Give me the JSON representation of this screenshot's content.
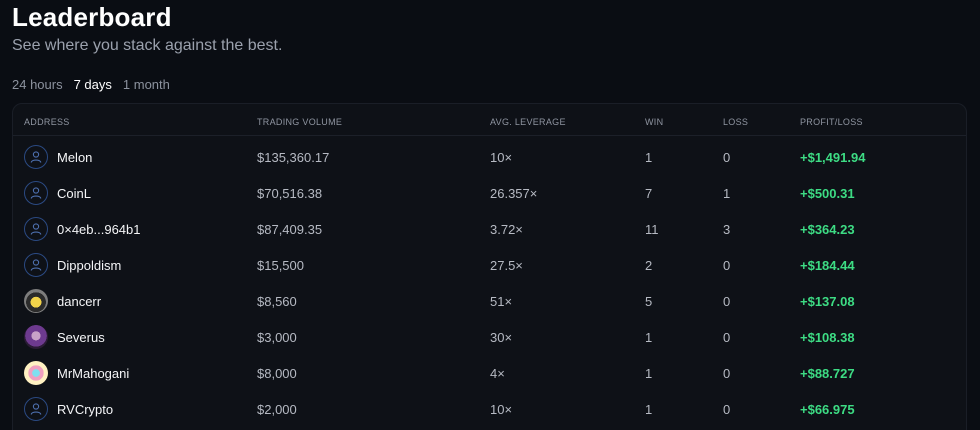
{
  "header": {
    "title": "Leaderboard",
    "subtitle": "See where you stack against the best."
  },
  "tabs": [
    {
      "label": "24 hours",
      "active": false
    },
    {
      "label": "7 days",
      "active": true
    },
    {
      "label": "1 month",
      "active": false
    }
  ],
  "table": {
    "columns": [
      "ADDRESS",
      "TRADING VOLUME",
      "AVG. LEVERAGE",
      "WIN",
      "LOSS",
      "PROFIT/LOSS"
    ],
    "rows": [
      {
        "name": "Melon",
        "avatar": "user-icon",
        "volume": "$135,360.17",
        "leverage": "10×",
        "win": "1",
        "loss": "0",
        "profit": "+$1,491.94"
      },
      {
        "name": "CoinL",
        "avatar": "user-icon",
        "volume": "$70,516.38",
        "leverage": "26.357×",
        "win": "7",
        "loss": "1",
        "profit": "+$500.31"
      },
      {
        "name": "0×4eb...964b1",
        "avatar": "user-icon",
        "volume": "$87,409.35",
        "leverage": "3.72×",
        "win": "11",
        "loss": "3",
        "profit": "+$364.23"
      },
      {
        "name": "Dippoldism",
        "avatar": "user-icon",
        "volume": "$15,500",
        "leverage": "27.5×",
        "win": "2",
        "loss": "0",
        "profit": "+$184.44"
      },
      {
        "name": "dancerr",
        "avatar": "profile-image",
        "volume": "$8,560",
        "leverage": "51×",
        "win": "5",
        "loss": "0",
        "profit": "+$137.08"
      },
      {
        "name": "Severus",
        "avatar": "profile-image",
        "volume": "$3,000",
        "leverage": "30×",
        "win": "1",
        "loss": "0",
        "profit": "+$108.38"
      },
      {
        "name": "MrMahogani",
        "avatar": "profile-image",
        "volume": "$8,000",
        "leverage": "4×",
        "win": "1",
        "loss": "0",
        "profit": "+$88.727"
      },
      {
        "name": "RVCrypto",
        "avatar": "user-icon",
        "volume": "$2,000",
        "leverage": "10×",
        "win": "1",
        "loss": "0",
        "profit": "+$66.975"
      }
    ]
  },
  "colors": {
    "background": "#0a0d13",
    "profit": "#3ddc84",
    "avatar_border": "#2b4a83"
  }
}
